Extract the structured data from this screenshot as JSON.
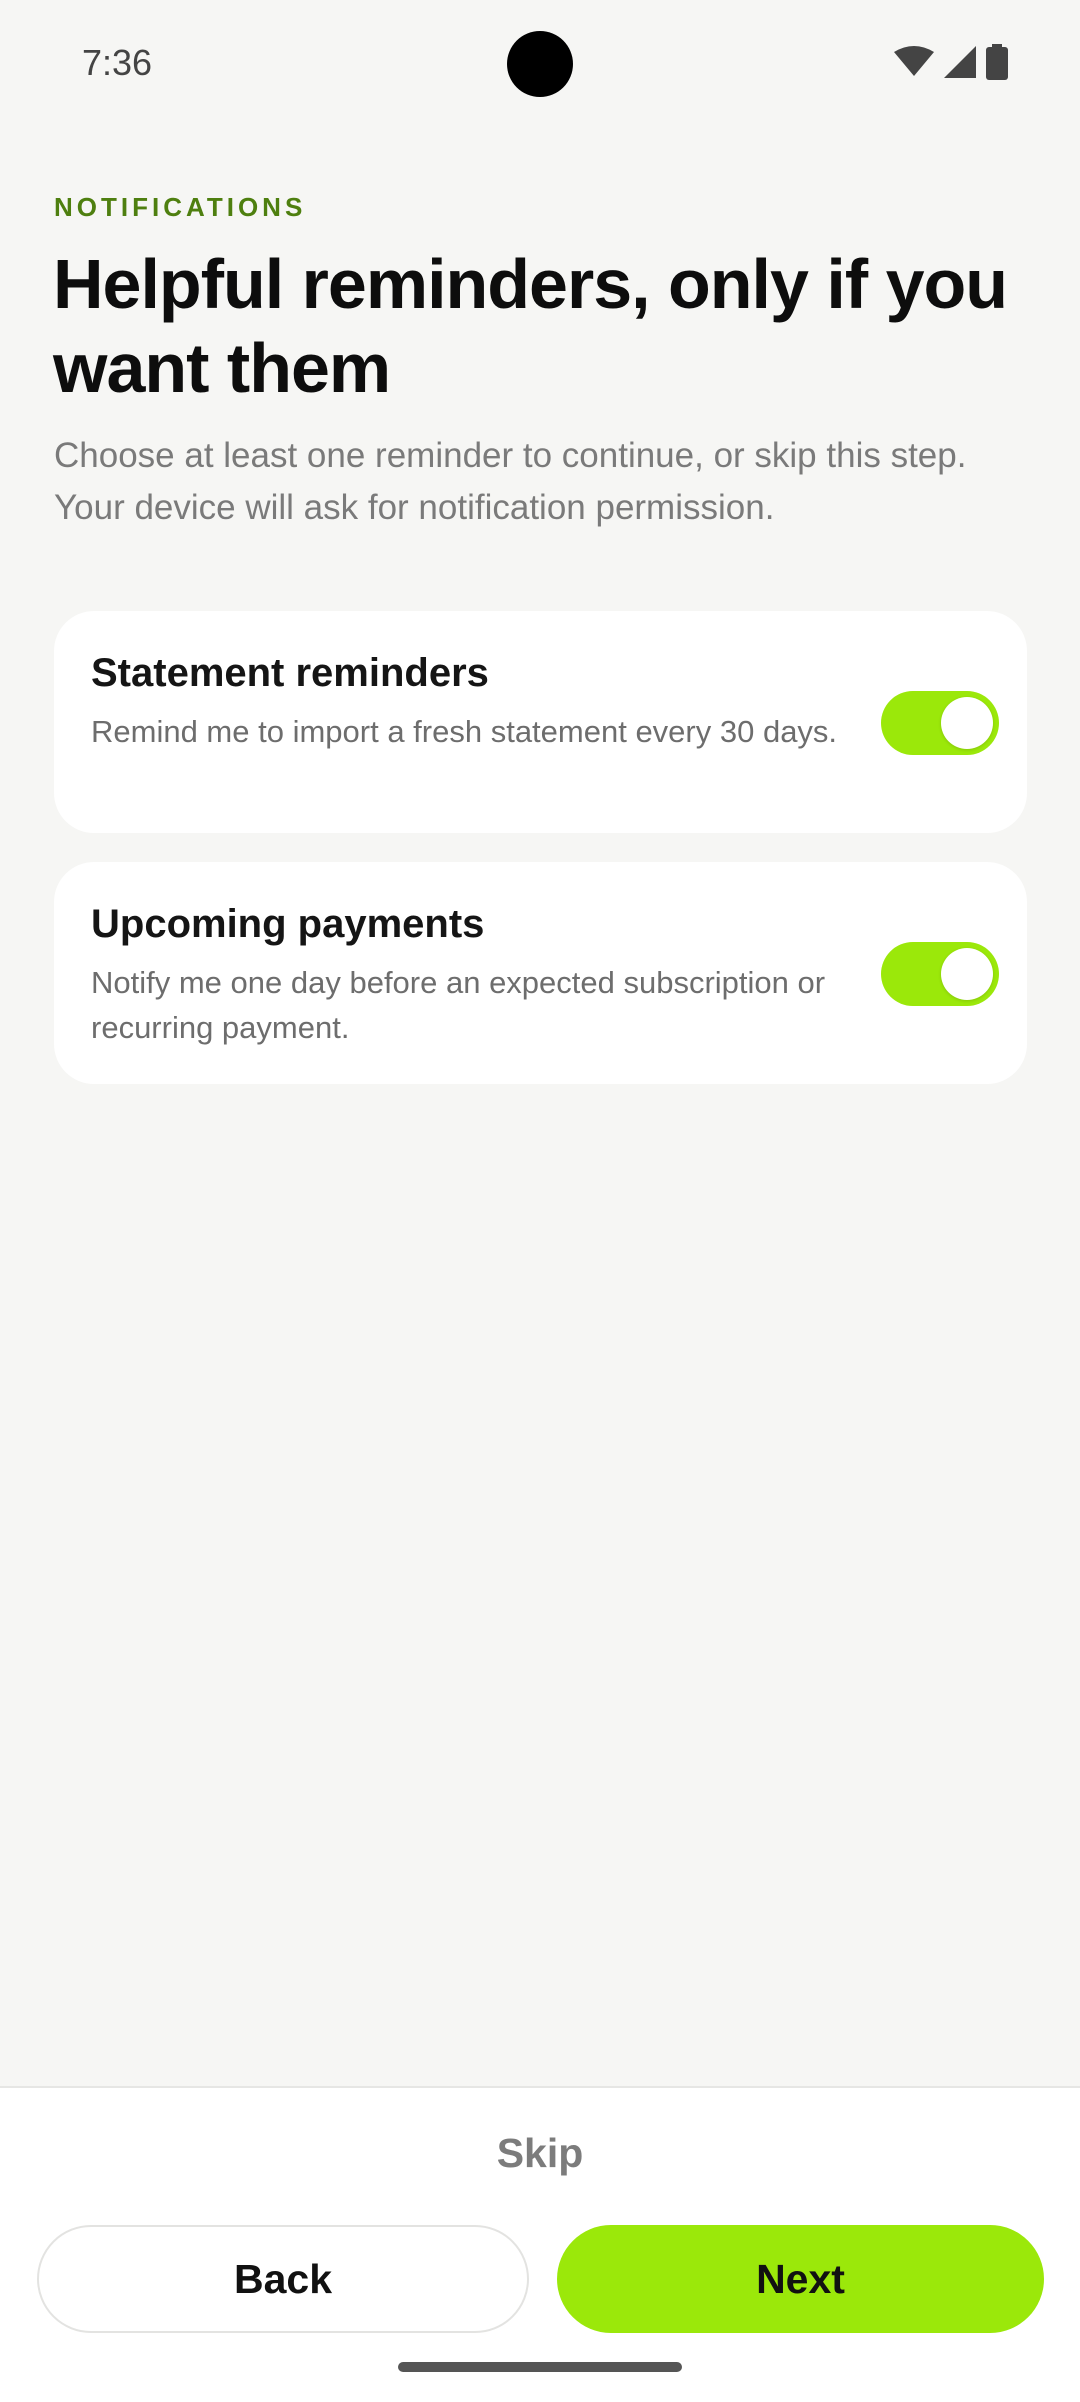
{
  "status_bar": {
    "time": "7:36",
    "icons": [
      "wifi-icon",
      "signal-icon",
      "battery-icon"
    ]
  },
  "header": {
    "eyebrow": "NOTIFICATIONS",
    "title": "Helpful reminders, only if you want them",
    "subtitle": "Choose at least one reminder to continue, or skip this step. Your device will ask for notification permission."
  },
  "options": [
    {
      "title": "Statement reminders",
      "description": "Remind me to import a fresh statement every 30 days.",
      "enabled": true
    },
    {
      "title": "Upcoming payments",
      "description": "Notify me one day before an expected subscription or recurring payment.",
      "enabled": true
    }
  ],
  "footer": {
    "skip_label": "Skip",
    "back_label": "Back",
    "next_label": "Next"
  },
  "colors": {
    "accent": "#9be80a",
    "eyebrow": "#4e7f0f",
    "background": "#f6f6f4"
  }
}
